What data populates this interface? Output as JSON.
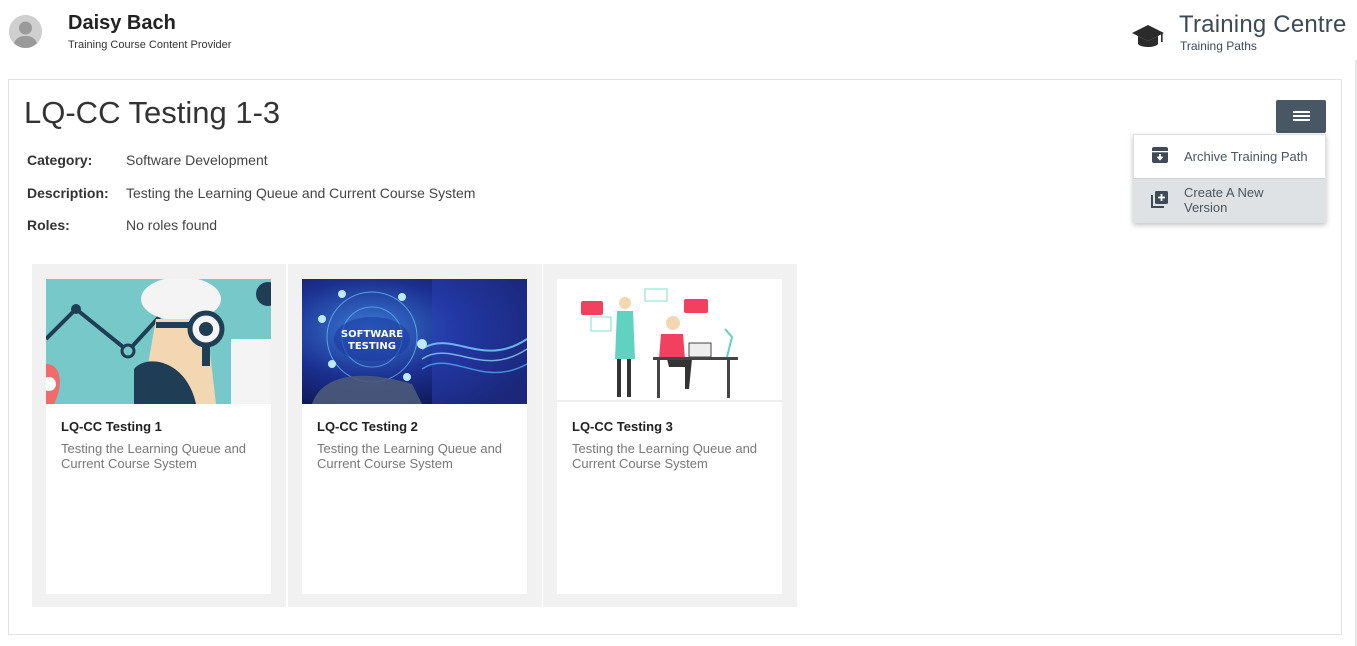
{
  "user": {
    "name": "Daisy Bach",
    "role": "Training Course Content Provider"
  },
  "brand": {
    "title": "Training Centre",
    "subtitle": "Training Paths",
    "icon": "graduation-cap-icon"
  },
  "path": {
    "title": "LQ-CC Testing 1-3",
    "fields": [
      {
        "label": "Category:",
        "value": "Software Development"
      },
      {
        "label": "Description:",
        "value": "Testing the Learning Queue and Current Course System"
      },
      {
        "label": "Roles:",
        "value": "No roles found"
      }
    ]
  },
  "menu": {
    "icon": "hamburger-menu-icon",
    "items": [
      {
        "label": "Archive Training Path",
        "icon": "archive-icon"
      },
      {
        "label": "Create A New Version",
        "icon": "add-library-icon"
      }
    ]
  },
  "courses": [
    {
      "title": "LQ-CC Testing 1",
      "description": "Testing the Learning Queue and Current Course System"
    },
    {
      "title": "LQ-CC Testing 2",
      "description": "Testing the Learning Queue and Current Course System",
      "image_text": "SOFTWARE TESTING"
    },
    {
      "title": "LQ-CC Testing 3",
      "description": "Testing the Learning Queue and Current Course System"
    }
  ],
  "colors": {
    "menu_button": "#475763",
    "dropdown_hover": "#dfe2e5",
    "brand_text": "#3d4a55"
  }
}
